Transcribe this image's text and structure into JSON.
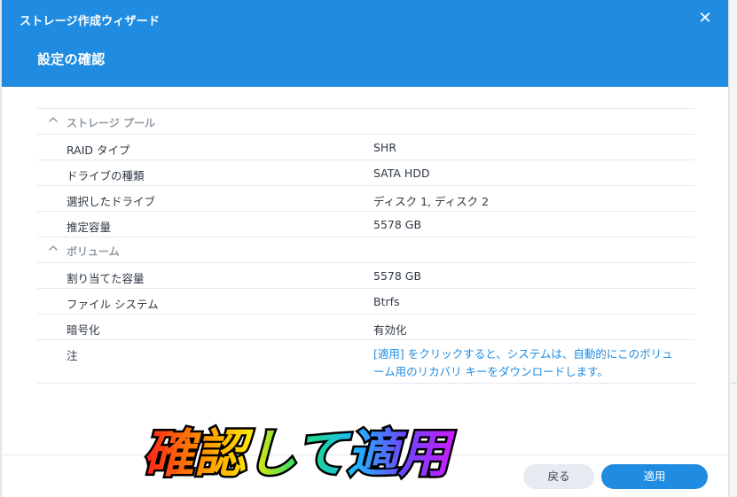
{
  "window": {
    "title": "ストレージ作成ウィザード",
    "close_icon": "close-icon",
    "page_title": "設定の確認"
  },
  "summary": {
    "sections": [
      {
        "label": "ストレージ プール",
        "rows": [
          {
            "key": "RAID タイプ",
            "value": "SHR"
          },
          {
            "key": "ドライブの種類",
            "value": "SATA HDD"
          },
          {
            "key": "選択したドライブ",
            "value": "ディスク 1, ディスク 2"
          },
          {
            "key": "推定容量",
            "value": "5578 GB"
          }
        ]
      },
      {
        "label": "ボリューム",
        "rows": [
          {
            "key": "割り当てた容量",
            "value": "5578 GB"
          },
          {
            "key": "ファイル システム",
            "value": "Btrfs"
          },
          {
            "key": "暗号化",
            "value": "有効化"
          },
          {
            "key": "注",
            "value": "[適用] をクリックすると、システムは、自動的にこのボリューム用のリカバリ キーをダウンロードします。"
          }
        ]
      }
    ]
  },
  "buttons": {
    "back": "戻る",
    "apply": "適用"
  },
  "overlay": {
    "text": "確認して適用"
  },
  "colors": {
    "accent": "#1f8ce2",
    "text": "#2f3844",
    "muted": "#8f98a3",
    "border": "#e6e9ee"
  }
}
